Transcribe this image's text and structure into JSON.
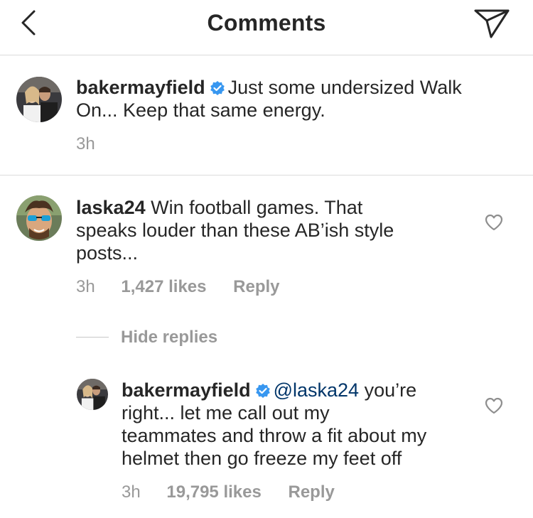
{
  "header": {
    "title": "Comments",
    "back_icon": "chevron-left-icon",
    "send_icon": "paper-plane-icon"
  },
  "caption": {
    "username": "bakermayfield",
    "text_line1": "Just some undersized Walk",
    "text_line2": "On... Keep that same energy.",
    "time": "3h"
  },
  "comments": [
    {
      "username": "laska24",
      "text_line1": "Win football games. That",
      "text_line2": "speaks louder than these AB’ish style",
      "text_line3": "posts...",
      "time": "3h",
      "likes": "1,427 likes",
      "reply": "Reply"
    }
  ],
  "replies_toggle": "Hide replies",
  "replies": [
    {
      "username": "bakermayfield",
      "mention": "@laska24",
      "text_line1": "you’re",
      "text_line2": "right... let me call out my",
      "text_line3": "teammates and throw a fit about my",
      "text_line4": "helmet then go freeze my feet off",
      "time": "3h",
      "likes": "19,795 likes",
      "reply": "Reply"
    }
  ],
  "colors": {
    "text": "#262626",
    "muted": "#999999",
    "divider": "#dbdbdb",
    "verified": "#3897f0",
    "mention": "#003569"
  }
}
